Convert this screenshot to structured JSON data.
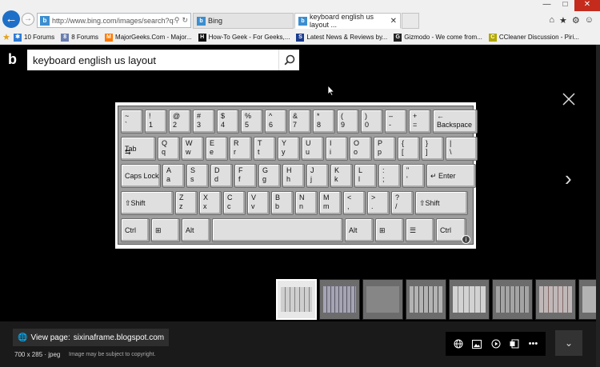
{
  "browser": {
    "url": "http://www.bing.com/images/search?q=|",
    "tabs": [
      {
        "label": "Bing"
      },
      {
        "label": "keyboard english us layout ..."
      }
    ],
    "favorites": [
      {
        "label": "10 Forums",
        "color": "#2e7bd6"
      },
      {
        "label": "8 Forums",
        "color": "#6a7fb0"
      },
      {
        "label": "MajorGeeks.Com - Major...",
        "color": "#ff7a00"
      },
      {
        "label": "How-To Geek - For Geeks,...",
        "color": "#111111"
      },
      {
        "label": "Latest News & Reviews by...",
        "color": "#1a3c8e"
      },
      {
        "label": "Gizmodo - We come from...",
        "color": "#222222"
      },
      {
        "label": "CCleaner Discussion - Piri...",
        "color": "#b3a800"
      }
    ]
  },
  "search": {
    "query": "keyboard english us layout"
  },
  "keyboard": {
    "rows": [
      [
        {
          "t": "~",
          "b": "`"
        },
        {
          "t": "!",
          "b": "1"
        },
        {
          "t": "@",
          "b": "2"
        },
        {
          "t": "#",
          "b": "3"
        },
        {
          "t": "$",
          "b": "4"
        },
        {
          "t": "%",
          "b": "5"
        },
        {
          "t": "^",
          "b": "6"
        },
        {
          "t": "&",
          "b": "7"
        },
        {
          "t": "*",
          "b": "8"
        },
        {
          "t": "(",
          "b": "9"
        },
        {
          "t": ")",
          "b": "0"
        },
        {
          "t": "–",
          "b": "-"
        },
        {
          "t": "+",
          "b": "="
        },
        {
          "t": "←",
          "b": "Backspace"
        }
      ],
      [
        {
          "t": "Tab",
          "b": "⇆"
        },
        {
          "t": "Q",
          "b": "q"
        },
        {
          "t": "W",
          "b": "w"
        },
        {
          "t": "E",
          "b": "e"
        },
        {
          "t": "R",
          "b": "r"
        },
        {
          "t": "T",
          "b": "t"
        },
        {
          "t": "Y",
          "b": "y"
        },
        {
          "t": "U",
          "b": "u"
        },
        {
          "t": "I",
          "b": "i"
        },
        {
          "t": "O",
          "b": "o"
        },
        {
          "t": "P",
          "b": "p"
        },
        {
          "t": "{",
          "b": "["
        },
        {
          "t": "}",
          "b": "]"
        },
        {
          "t": "|",
          "b": "\\"
        }
      ],
      [
        {
          "t": "Caps Lock",
          "b": ""
        },
        {
          "t": "A",
          "b": "a"
        },
        {
          "t": "S",
          "b": "s"
        },
        {
          "t": "D",
          "b": "d"
        },
        {
          "t": "F",
          "b": "f"
        },
        {
          "t": "G",
          "b": "g"
        },
        {
          "t": "H",
          "b": "h"
        },
        {
          "t": "J",
          "b": "j"
        },
        {
          "t": "K",
          "b": "k"
        },
        {
          "t": "L",
          "b": "l"
        },
        {
          "t": ":",
          "b": ";"
        },
        {
          "t": "\"",
          "b": "'"
        },
        {
          "t": "↵ Enter",
          "b": ""
        }
      ],
      [
        {
          "t": "⇧Shift",
          "b": ""
        },
        {
          "t": "Z",
          "b": "z"
        },
        {
          "t": "X",
          "b": "x"
        },
        {
          "t": "C",
          "b": "c"
        },
        {
          "t": "V",
          "b": "v"
        },
        {
          "t": "B",
          "b": "b"
        },
        {
          "t": "N",
          "b": "n"
        },
        {
          "t": "M",
          "b": "m"
        },
        {
          "t": "<",
          "b": ","
        },
        {
          "t": ">",
          "b": "."
        },
        {
          "t": "?",
          "b": "/"
        },
        {
          "t": "⇧Shift",
          "b": ""
        }
      ],
      [
        {
          "t": "Ctrl",
          "b": ""
        },
        {
          "t": "⊞",
          "b": ""
        },
        {
          "t": "Alt",
          "b": ""
        },
        {
          "t": "",
          "b": ""
        },
        {
          "t": "Alt",
          "b": ""
        },
        {
          "t": "⊞",
          "b": ""
        },
        {
          "t": "☰",
          "b": ""
        },
        {
          "t": "Ctrl",
          "b": ""
        }
      ]
    ]
  },
  "footer": {
    "view_page_label": "View page:",
    "view_page_source": "sixinaframe.blogspot.com",
    "image_info": "700 x 285 · jpeg",
    "copyright": "Image may be subject to copyright."
  },
  "colors": {
    "accent": "#1e6fc7",
    "background": "#000000"
  }
}
